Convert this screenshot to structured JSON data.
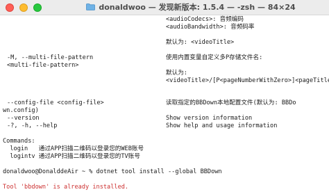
{
  "window": {
    "folder_icon": "folder-icon",
    "title": "donaldwoo — 发现新版本: 1.5.4 — -zsh — 84×24"
  },
  "terminal": {
    "lines": [
      {
        "key": "audio_codecs",
        "text": "<audioCodecs>: 音频编码"
      },
      {
        "key": "audio_bandwidth",
        "text": "<audioBandwidth>: 音频码率"
      },
      {
        "key": "default_label_1",
        "text": "默认为: <videoTitle>"
      },
      {
        "key": "multi_file_option",
        "text": "-M, --multi-file-pattern"
      },
      {
        "key": "multi_file_desc",
        "text": "使用内置变量自定义多P存储文件名:"
      },
      {
        "key": "multi_file_arg",
        "text": "<multi-file-pattern>"
      },
      {
        "key": "default_label_2",
        "text": "默认为:"
      },
      {
        "key": "default_value_2",
        "text": "<videoTitle>/[P<pageNumberWithZero>]<pageTitle>"
      },
      {
        "key": "config_option",
        "text": "--config-file <config-file>"
      },
      {
        "key": "config_desc",
        "text": "读取指定的BBDown本地配置文件(默认为: BBDo"
      },
      {
        "key": "config_wrap",
        "text": "wn.config)"
      },
      {
        "key": "version_option",
        "text": "--version"
      },
      {
        "key": "version_desc",
        "text": "Show version information"
      },
      {
        "key": "help_option",
        "text": "-?, -h, --help"
      },
      {
        "key": "help_desc",
        "text": "Show help and usage information"
      },
      {
        "key": "commands_header",
        "text": "Commands:"
      },
      {
        "key": "login_cmd",
        "text": "  login   通过APP扫描二维码以登录您的WEB账号"
      },
      {
        "key": "logintv_cmd",
        "text": "  logintv 通过APP扫描二维码以登录您的TV账号"
      },
      {
        "key": "prompt_command",
        "text": "donaldwoo@DonalddeAir ~ % dotnet tool install --global BBDown"
      },
      {
        "key": "error_message",
        "text": "Tool 'bbdown' is already installed."
      }
    ]
  }
}
